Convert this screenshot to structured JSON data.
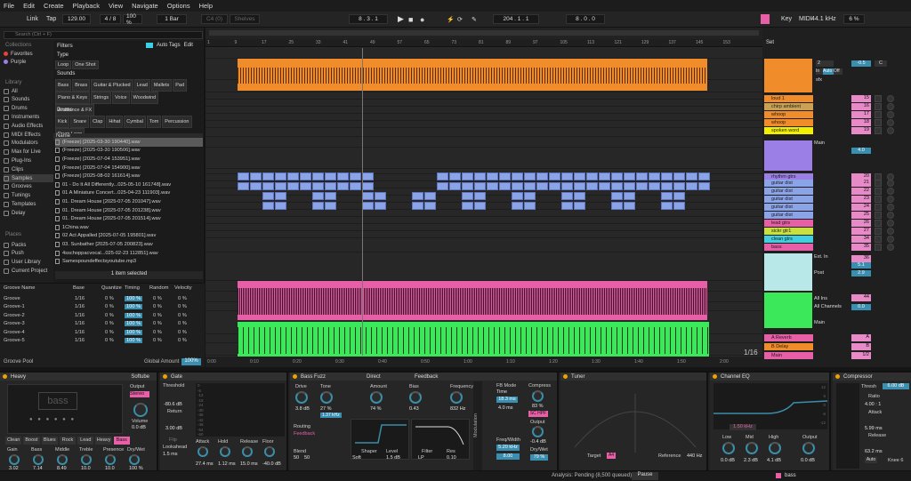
{
  "menu": [
    "File",
    "Edit",
    "Create",
    "Playback",
    "View",
    "Navigate",
    "Options",
    "Help"
  ],
  "transport": {
    "link": "Link",
    "tap": "Tap",
    "tempo": "129.00",
    "sig": "4 / 8",
    "zoom": "100 %",
    "bar": "1 Bar",
    "midi_in": "C4 (0)",
    "midi_type": "Shelves",
    "pos": "8 .  3 .  1",
    "loop_start": "204 .  1 .  1",
    "loop_len": "8 .  0 .  0",
    "key": "Key",
    "midi": "MIDI",
    "rate": "44.1 kHz",
    "cpu": "6 %"
  },
  "browser": {
    "search": "Search (Ctrl + F)",
    "collections_label": "Collections",
    "collections": [
      "Favorites",
      "Purple"
    ],
    "library_label": "Library",
    "library": [
      "All",
      "Sounds",
      "Drums",
      "Instruments",
      "Audio Effects",
      "MIDI Effects",
      "Modulators",
      "Max for Live",
      "Plug-Ins",
      "Clips",
      "Samples",
      "Grooves",
      "Tunings",
      "Templates",
      "Delay"
    ],
    "places_label": "Places",
    "places": [
      "Packs",
      "Push",
      "User Library",
      "Current Project"
    ],
    "filters": "Filters",
    "auto_tags": "Auto Tags",
    "edit": "Edit",
    "type_label": "Type",
    "type_tags": [
      "Loop",
      "One Shot"
    ],
    "sounds_label": "Sounds",
    "sounds_tags": [
      "Bass",
      "Brass",
      "Guitar & Plucked",
      "Lead",
      "Mallets",
      "Pad",
      "Piano & Keys",
      "Strings",
      "Voice",
      "Woodwind",
      "Ambience & FX"
    ],
    "drums_label": "Drums",
    "drums_tags": [
      "Kick",
      "Snare",
      "Clap",
      "Hihat",
      "Cymbal",
      "Tom",
      "Percussion",
      "Drum Loop"
    ],
    "name_col": "Name",
    "files": [
      "(Freeze) [2025-03-30 190440].wav",
      "(Freeze) [2025-03-30 190506].wav",
      "(Freeze) [2025-07-04 153951].wav",
      "(Freeze) [2025-07-04 154900].wav",
      "(Freeze) [2025-08-02 161614].wav",
      "01 - Do It All Differently...025-05-10 161748].wav",
      "01 A Miniature Concert...025-04-23 111903].wav",
      "01. Dream House [2025-07-05 201047].wav",
      "01. Dream House [2025-07-05 201238].wav",
      "01. Dream House [2025-07-05 201514].wav",
      "1China.wav",
      "02 Act Appalled [2025-07-05 195801].wav",
      "03. Sunbather [2025-07-05 200823].wav",
      "4sschoppacvocal...025-02-23 112851].wav",
      "Samespoundeffectsyoutube.mp3"
    ],
    "selected_status": "1 item selected"
  },
  "groove": {
    "cols": [
      "Groove Name",
      "Base",
      "Quantize",
      "Timing",
      "Random",
      "Velocity"
    ],
    "rows": [
      {
        "name": "Groove",
        "base": "1/16",
        "q": "0 %",
        "t": "100 %",
        "r": "0 %",
        "v": "0 %"
      },
      {
        "name": "Groove-1",
        "base": "1/16",
        "q": "0 %",
        "t": "100 %",
        "r": "0 %",
        "v": "0 %"
      },
      {
        "name": "Groove-2",
        "base": "1/16",
        "q": "0 %",
        "t": "100 %",
        "r": "0 %",
        "v": "0 %"
      },
      {
        "name": "Groove-3",
        "base": "1/16",
        "q": "0 %",
        "t": "100 %",
        "r": "0 %",
        "v": "0 %"
      },
      {
        "name": "Groove-4",
        "base": "1/16",
        "q": "0 %",
        "t": "100 %",
        "r": "0 %",
        "v": "0 %"
      },
      {
        "name": "Groove-5",
        "base": "1/16",
        "q": "0 %",
        "t": "100 %",
        "r": "0 %",
        "v": "0 %"
      }
    ],
    "pool": "Groove Pool",
    "global": "Global Amount",
    "global_val": "100%"
  },
  "ruler": [
    "1",
    "9",
    "17",
    "25",
    "33",
    "41",
    "49",
    "57",
    "65",
    "73",
    "81",
    "89",
    "97",
    "105",
    "113",
    "121",
    "129",
    "137",
    "145",
    "153"
  ],
  "timeline": [
    "0:00",
    "0:10",
    "0:20",
    "0:30",
    "0:40",
    "0:50",
    "1:00",
    "1:10",
    "1:20",
    "1:30",
    "1:40",
    "1:50",
    "2:00"
  ],
  "grid": "1/16",
  "mixer": {
    "set": "Set",
    "tracks": [
      {
        "name": "loud 1",
        "color": "#f08c2a",
        "vol": "15"
      },
      {
        "name": "chirp ambient",
        "color": "#c9a256",
        "vol": "16"
      },
      {
        "name": "whoop",
        "color": "#f08c2a",
        "vol": "17"
      },
      {
        "name": "whoop",
        "color": "#f08c2a",
        "vol": "18"
      },
      {
        "name": "spoken word",
        "color": "#f0f000",
        "vol": "19"
      },
      {
        "name": "rhythm gtrs",
        "color": "#9b7ee6",
        "vol": "20"
      },
      {
        "name": "guitar dist",
        "color": "#8ba4e8",
        "vol": "21"
      },
      {
        "name": "guitar dist",
        "color": "#8ba4e8",
        "vol": "22"
      },
      {
        "name": "guitar dist",
        "color": "#8ba4e8",
        "vol": "23"
      },
      {
        "name": "guitar dist",
        "color": "#8ba4e8",
        "vol": "24"
      },
      {
        "name": "guitar dist",
        "color": "#8ba4e8",
        "vol": "25"
      },
      {
        "name": "lead gtrs",
        "color": "#e85fa8",
        "vol": "26"
      },
      {
        "name": "sickr gtr1",
        "color": "#c8e040",
        "vol": "27"
      },
      {
        "name": "clean gtrs",
        "color": "#3fd0e0",
        "vol": "34"
      },
      {
        "name": "bass",
        "color": "#e85fa8",
        "vol": "35"
      },
      {
        "name": "bass",
        "color": "#b8e8e8",
        "vol": "36"
      },
      {
        "name": "drums",
        "color": "#3ae85a",
        "vol": "44"
      },
      {
        "name": "A Reverb",
        "color": "#e85fa8",
        "vol": "A"
      },
      {
        "name": "B Delay",
        "color": "#f08c2a",
        "vol": "B"
      },
      {
        "name": "Main",
        "color": "#e85fa8",
        "vol": "1/2"
      }
    ],
    "io": [
      "Main",
      "Ext. In",
      "Post",
      "All Ins",
      "All Channels",
      "Main",
      "sfx",
      "Auto",
      "Off"
    ],
    "vals": [
      "-0.5",
      "C",
      "4.0",
      "0.0",
      "5.1",
      "2.9"
    ]
  },
  "devices": {
    "heavy": {
      "title": "Heavy",
      "preset": "Softube",
      "name": "bass",
      "output_label": "Output",
      "output_val": "Stereo",
      "volume_label": "Volume",
      "volume_val": "0.0 dB",
      "modes": [
        "Clean",
        "Boost",
        "Blues",
        "Rock",
        "Lead",
        "Heavy",
        "Bass"
      ],
      "knobs": [
        {
          "l": "Gain",
          "v": "3.02"
        },
        {
          "l": "Bass",
          "v": "7.14"
        },
        {
          "l": "Middle",
          "v": "8.49"
        },
        {
          "l": "Treble",
          "v": "10.0"
        },
        {
          "l": "Presence",
          "v": "10.0"
        },
        {
          "l": "Dry/Wet",
          "v": "100 %"
        }
      ]
    },
    "gate": {
      "title": "Gate",
      "threshold": "Threshold",
      "thr_val": "-80.6 dB",
      "return": "Return",
      "ret_val": "3.00 dB",
      "flip": "Flip",
      "look": "Lookahead",
      "look_val": "1.5 ms",
      "attack": "Attack",
      "att_val": "27.4 ms",
      "hold": "Hold",
      "hold_val": "1.12 ms",
      "release": "Release",
      "rel_val": "15.0 ms",
      "floor": "Floor",
      "floor_val": "-40.0 dB",
      "scale": [
        "0",
        "-6",
        "-12",
        "-18",
        "-24",
        "-30",
        "-36",
        "-42",
        "-48",
        "-54",
        "-60"
      ]
    },
    "fuzz": {
      "title": "Bass Fuzz",
      "direct": "Direct",
      "feedback": "Feedback",
      "drive": "Drive",
      "drive_val": "3.8 dB",
      "tone": "Tone",
      "tone_val": "27 %",
      "tone_hz": "1.37 kHz",
      "amount": "Amount",
      "amount_val": "74 %",
      "bias": "Bias",
      "bias_val": "0.43",
      "frequency": "Frequency",
      "freq_val": "832 Hz",
      "routing": "Routing",
      "routing_val": "Feedback",
      "shaper": "Shaper",
      "shaper_val": "Soft",
      "level": "Level",
      "level_val": "1.5 dB",
      "filter": "Filter",
      "filter_val": "LP",
      "res": "Res",
      "res_val": "0.10",
      "blend": "Blend",
      "blend_vals": [
        "50",
        "50"
      ],
      "fb_mode": "FB Mode",
      "fb_val": "Time",
      "time_val": "18.3 ms",
      "ms_val": "4.0 ms",
      "compress": "Compress",
      "comp_val": "83 %",
      "sc_hpf": "SC HPF",
      "output": "Output",
      "out_val": "-0.4 dB",
      "freq_width": "Freq/Width",
      "fw_val": "5.20 kHz",
      "fw2": "8.00",
      "drywet": "Dry/Wet",
      "dw_val": "79 %",
      "modulation": "Modulation"
    },
    "tuner": {
      "title": "Tuner",
      "target": "Target",
      "target_val": "A4",
      "reference": "Reference",
      "ref_val": "440 Hz"
    },
    "eq": {
      "title": "Channel EQ",
      "freq": "1.50 kHz",
      "low": "Low",
      "low_val": "0.0 dB",
      "mid": "Mid",
      "mid_val": "2.3 dB",
      "high": "High",
      "high_val": "4.1 dB",
      "output": "Output",
      "out_val": "0.0 dB",
      "scale": [
        "12",
        "6",
        "0",
        "-6",
        "-12"
      ]
    },
    "comp": {
      "title": "Compressor",
      "thresh": "Thresh",
      "thresh_val": "6.00 dB",
      "ratio": "Ratio",
      "ratio_val": "4.00 : 1",
      "attack": "Attack",
      "att_val": "5.99 ms",
      "release": "Release",
      "rel_val": "63.2 ms",
      "auto": "Auto",
      "knee": "Knee 6"
    }
  },
  "status": {
    "analysis": "Analysis: Pending (8,500 queued)",
    "pause": "Pause",
    "track": "bass"
  },
  "colors": {
    "orange": "#f08c2a",
    "pink": "#e85fa8",
    "green": "#3ae85a",
    "blue": "#8ba4e8",
    "accent": "#3b8ea8"
  }
}
